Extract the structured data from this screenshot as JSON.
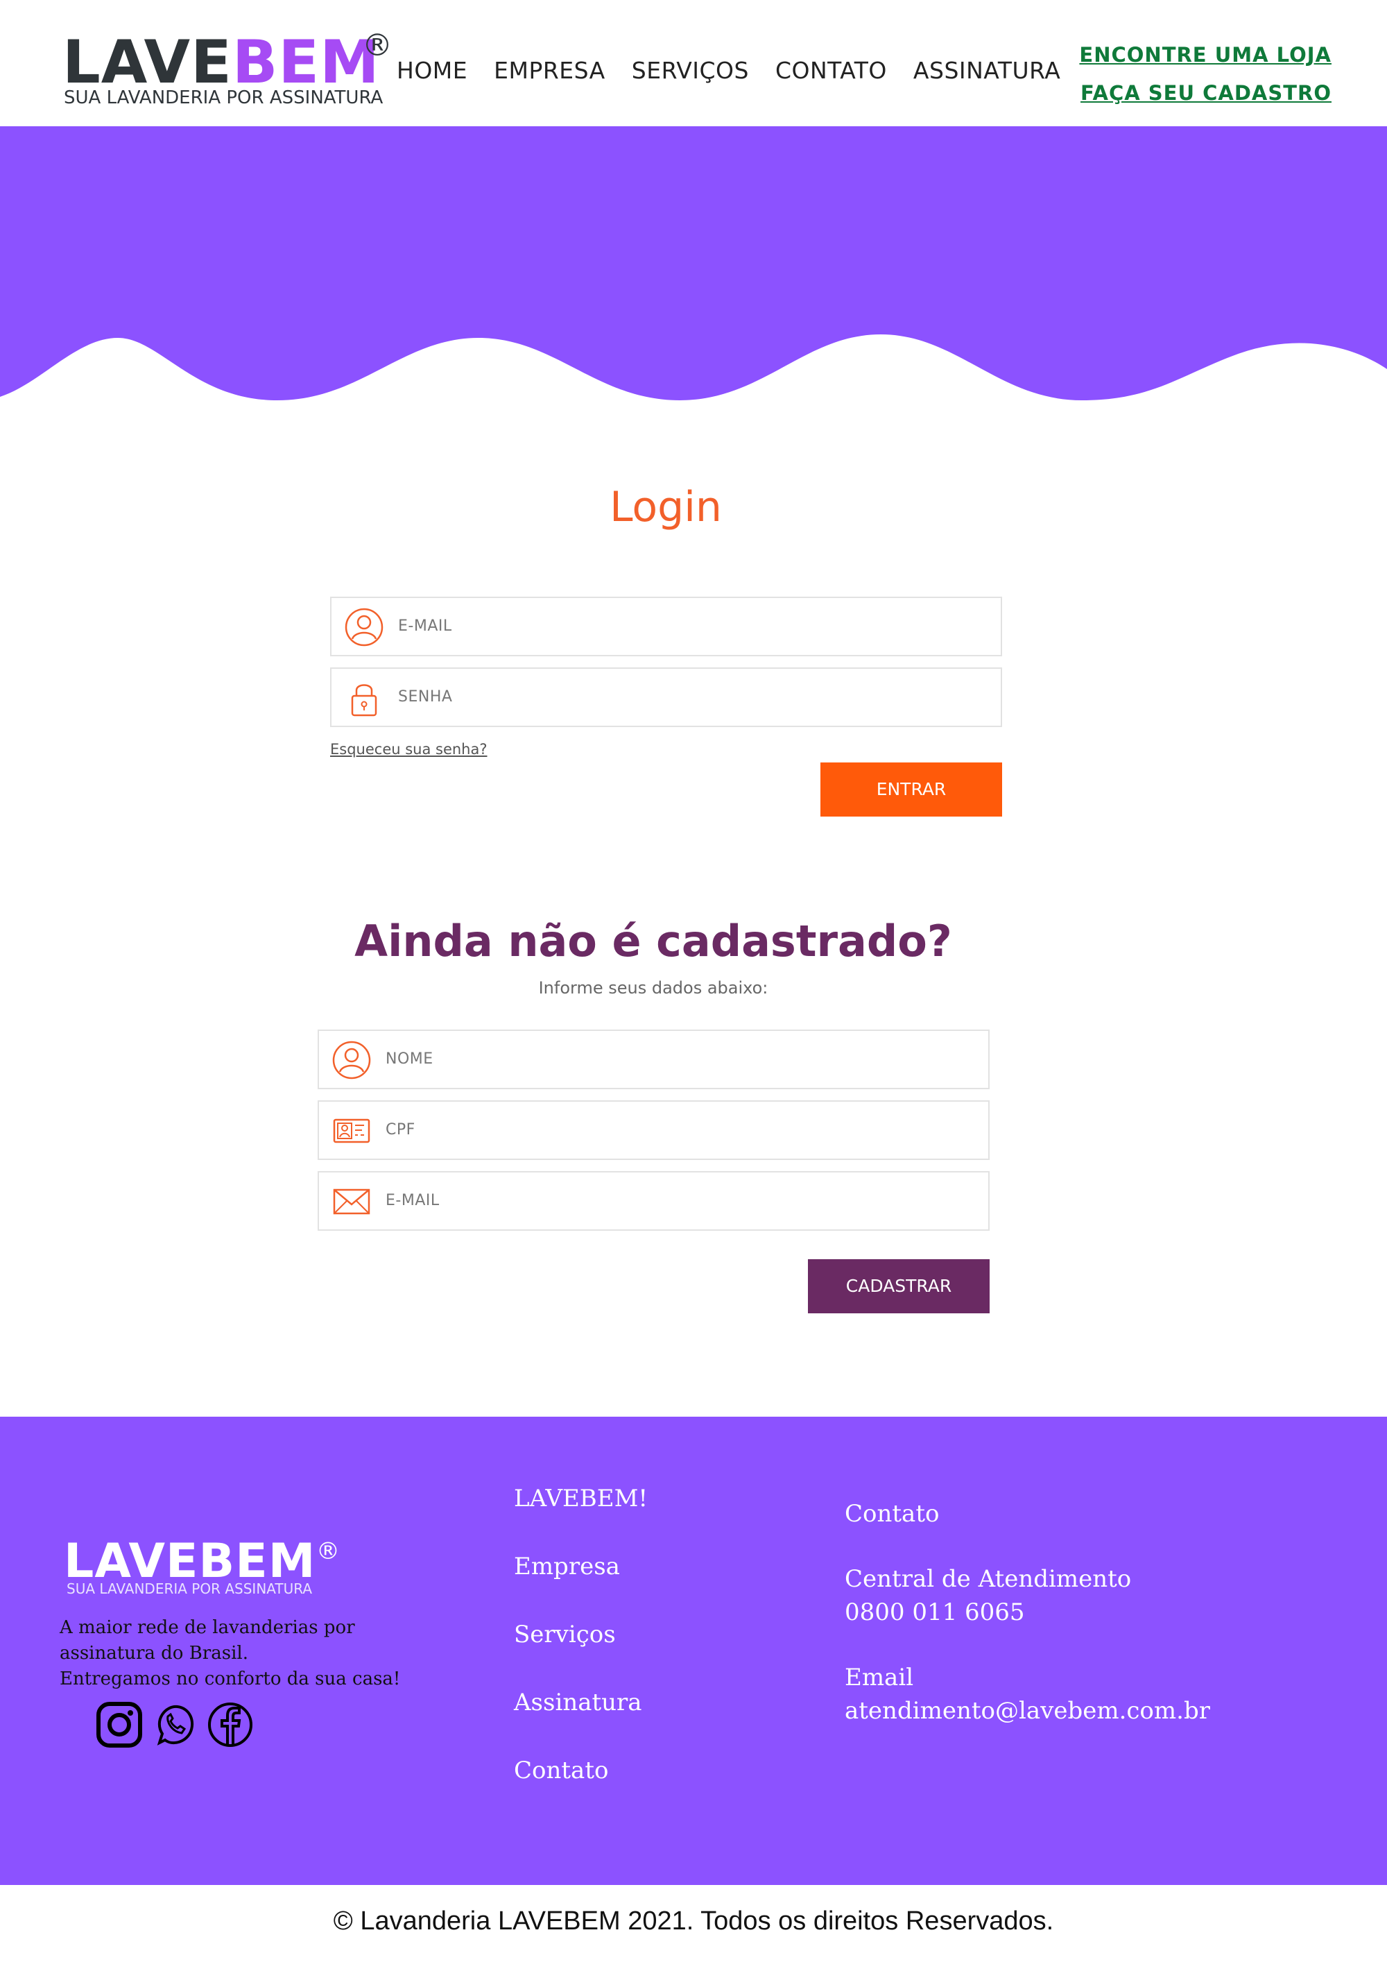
{
  "header": {
    "logo": {
      "part1": "LAVE",
      "part2": "BEM",
      "reg": "®",
      "tagline": "SUA LAVANDERIA POR ASSINATURA"
    },
    "nav": [
      "HOME",
      "EMPRESA",
      "SERVIÇOS",
      "CONTATO",
      "ASSINATURA"
    ],
    "cta_store": "ENCONTRE UMA LOJA",
    "cta_register": "FAÇA SEU CADASTRO"
  },
  "colors": {
    "brand_purple": "#8c52ff",
    "logo_purple": "#a64bf4",
    "orange": "#ff5a0a",
    "plum": "#6a2a63",
    "green": "#0f7a3a"
  },
  "login": {
    "title": "Login",
    "email_placeholder": "E-MAIL",
    "password_placeholder": "SENHA",
    "forgot": "Esqueceu sua senha?",
    "submit": "ENTRAR",
    "icons": [
      "user-icon",
      "lock-icon"
    ]
  },
  "register": {
    "title": "Ainda não é cadastrado?",
    "subtitle": "Informe seus dados abaixo:",
    "name_placeholder": "NOME",
    "cpf_placeholder": "CPF",
    "email_placeholder": "E-MAIL",
    "submit": "CADASTRAR",
    "icons": [
      "user-icon",
      "id-card-icon",
      "envelope-icon"
    ]
  },
  "footer": {
    "logo": {
      "word": "LAVEBEM",
      "reg": "®",
      "tagline": "SUA LAVANDERIA POR ASSINATURA"
    },
    "description": [
      "A maior rede de lavanderias por",
      "assinatura do Brasil.",
      "Entregamos no conforto da sua casa!"
    ],
    "social": [
      "instagram-icon",
      "whatsapp-icon",
      "facebook-icon"
    ],
    "links": [
      "LAVEBEM!",
      "Empresa",
      "Serviços",
      "Assinatura",
      "Contato"
    ],
    "contact_title": "Contato",
    "support_label": "Central de Atendimento",
    "support_phone": "0800 011 6065",
    "email_label": "Email",
    "email": "atendimento@lavebem.com.br"
  },
  "copyright": "© Lavanderia LAVEBEM 2021. Todos os direitos Reservados."
}
